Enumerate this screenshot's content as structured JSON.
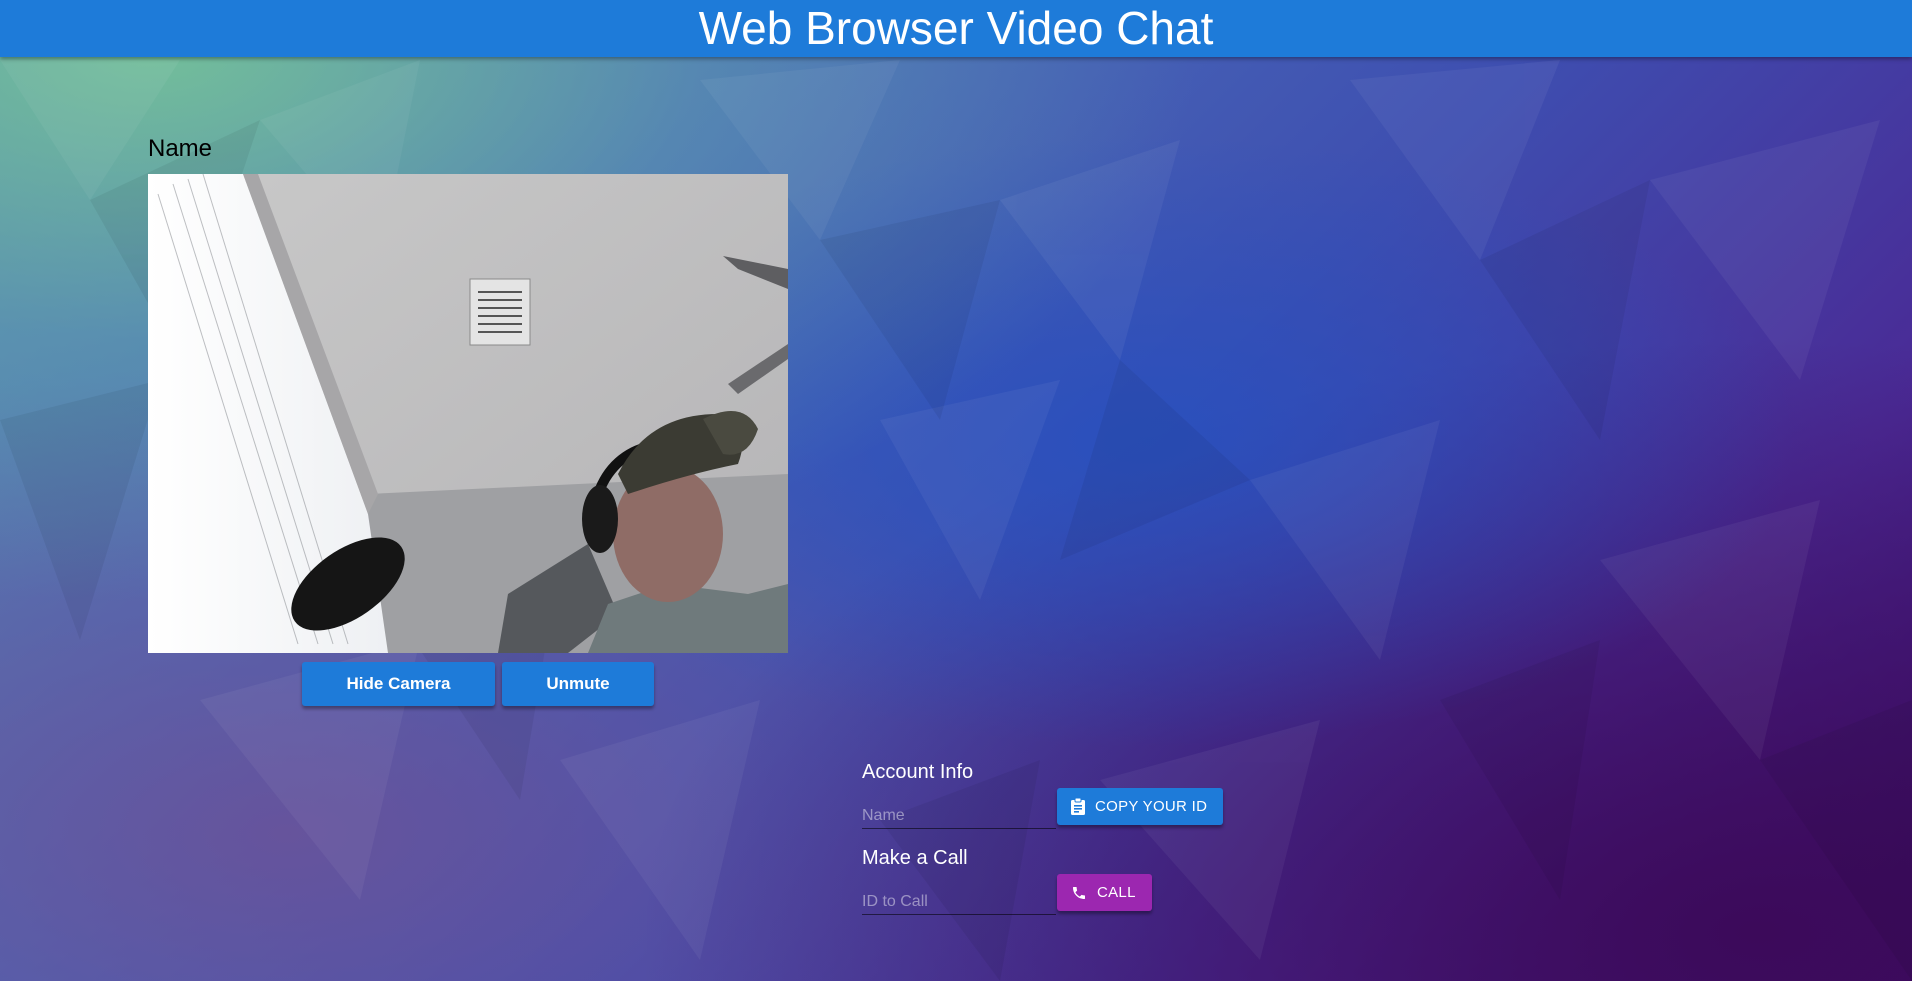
{
  "header": {
    "title": "Web Browser Video Chat"
  },
  "local_video": {
    "name_label": "Name",
    "hide_camera_label": "Hide Camera",
    "unmute_label": "Unmute"
  },
  "account_info": {
    "heading": "Account Info",
    "name_placeholder": "Name",
    "copy_id_label": "COPY YOUR ID",
    "copy_icon": "clipboard-icon"
  },
  "make_call": {
    "heading": "Make a Call",
    "id_placeholder": "ID to Call",
    "call_label": "CALL",
    "call_icon": "phone-icon"
  },
  "colors": {
    "app_bar": "#1e7bd9",
    "primary_button": "#1e7bd9",
    "call_button": "#9c27b0"
  }
}
